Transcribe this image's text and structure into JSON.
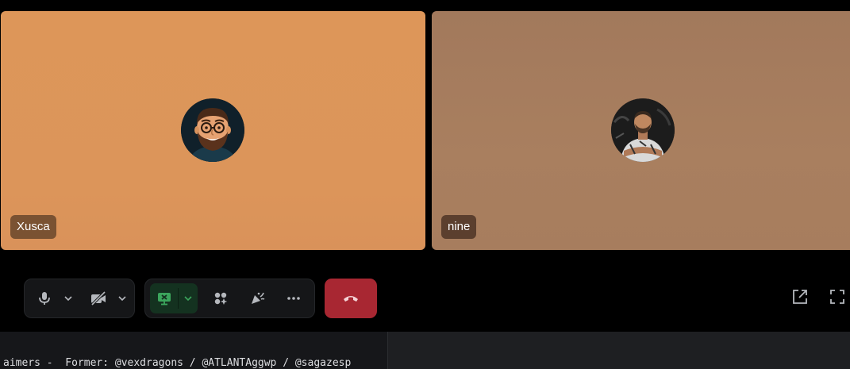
{
  "participants": [
    {
      "name": "Xusca",
      "avatar_icon": "cartoon-bearded-man-avatar-icon",
      "tile_color": "#dd9659"
    },
    {
      "name": "nine",
      "avatar_icon": "user-photo-avatar-icon",
      "tile_color": "#a77d5e"
    }
  ],
  "controls": {
    "av": [
      {
        "icon": "microphone-icon"
      },
      {
        "icon": "chevron-down-icon"
      },
      {
        "icon": "camera-off-icon"
      },
      {
        "icon": "chevron-down-icon"
      }
    ],
    "tools": [
      {
        "icon": "screen-share-icon",
        "active": true
      },
      {
        "icon": "chevron-down-icon"
      },
      {
        "icon": "activities-icon"
      },
      {
        "icon": "soundboard-icon"
      },
      {
        "icon": "more-options-icon"
      }
    ],
    "end_call": {
      "icon": "phone-hangup-icon",
      "color": "#a82732"
    },
    "right": [
      {
        "icon": "pop-out-icon"
      },
      {
        "icon": "fullscreen-icon"
      }
    ]
  },
  "bottom": {
    "bio": "aimers -  Former: @vexdragons / @ATLANTAggwp / @sagazesp"
  },
  "colors": {
    "background": "#000000",
    "control_bg": "#151618",
    "share_active_bg": "#143220",
    "share_active_icon": "#3ba55c"
  }
}
